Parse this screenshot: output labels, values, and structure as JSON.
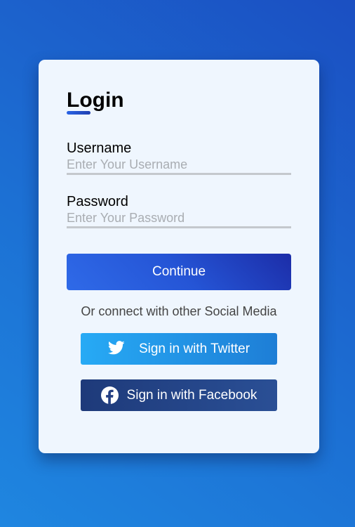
{
  "login": {
    "title": "Login",
    "username_label": "Username",
    "username_placeholder": "Enter Your Username",
    "username_value": "",
    "password_label": "Password",
    "password_placeholder": "Enter Your Password",
    "password_value": "",
    "continue_label": "Continue",
    "social_text": "Or connect with other Social Media",
    "twitter_label": "Sign in with Twitter",
    "facebook_label": "Sign in with Facebook",
    "icons": {
      "twitter": "twitter-bird-icon",
      "facebook": "facebook-icon"
    },
    "colors": {
      "background": "#1c6fd3",
      "card": "#eff6fe",
      "continue": "#2555d6",
      "twitter": "#1e9be8",
      "facebook": "#243f83"
    }
  }
}
